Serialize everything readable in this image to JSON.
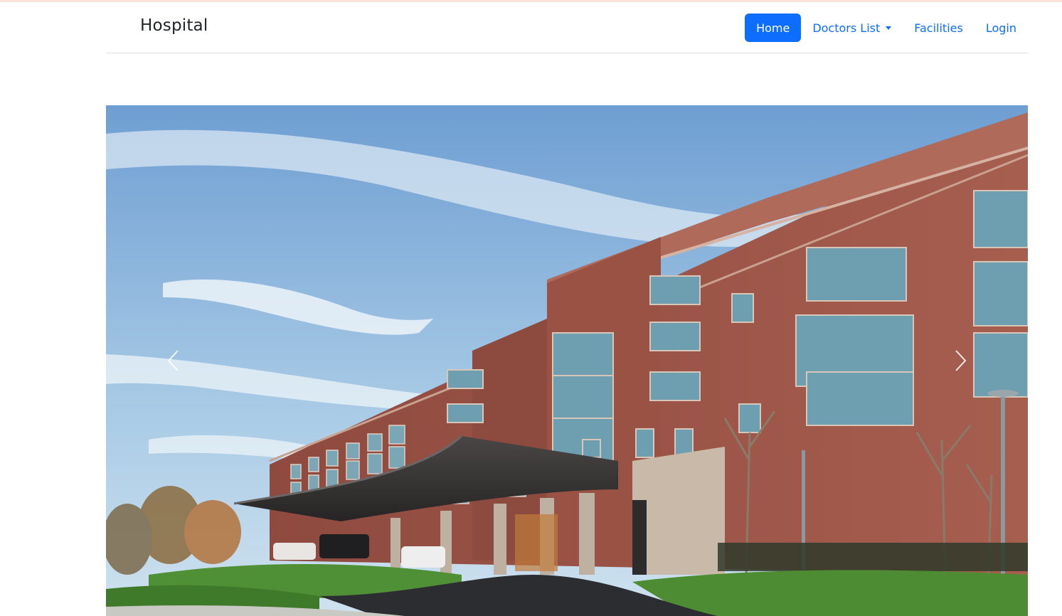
{
  "brand": {
    "name": "Hospital"
  },
  "nav": {
    "items": [
      {
        "label": "Home",
        "active": true
      },
      {
        "label": "Doctors List",
        "dropdown": true
      },
      {
        "label": "Facilities"
      },
      {
        "label": "Login"
      }
    ]
  },
  "carousel": {
    "slide_subject": "hospital building photo",
    "prev_icon": "chevron-left-icon",
    "next_icon": "chevron-right-icon"
  },
  "colors": {
    "primary": "#0d6efd",
    "brand_text": "#212529",
    "sky_top": "#6f9fd3",
    "sky_bottom": "#bcd7ea",
    "brick": "#9a5347",
    "glass": "#6b9cae",
    "lawn": "#4f8f35"
  }
}
